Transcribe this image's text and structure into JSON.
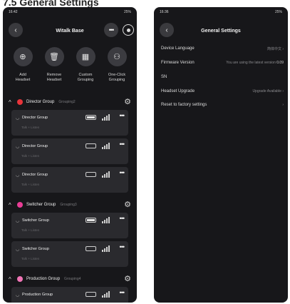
{
  "page_heading": "7.5 General Settings",
  "left": {
    "status_time": "16:42",
    "status_right": "25%",
    "title": "Witalk Base",
    "actions": [
      {
        "label": "Add\nHeadset",
        "icon": "plus-square-icon"
      },
      {
        "label": "Remove\nHeadset",
        "icon": "trash-icon"
      },
      {
        "label": "Custom\nGrouping",
        "icon": "grid-icon"
      },
      {
        "label": "One-Click\nGrouping",
        "icon": "people-icon"
      }
    ],
    "groups": [
      {
        "name": "Director Group",
        "sub": "Grouping2",
        "color": "#e8343a",
        "cards": [
          {
            "name": "Director Group",
            "sub": "Talk + Listen",
            "battery": 0.85
          },
          {
            "name": "Director Group",
            "sub": "Talk + Listen",
            "battery": 0
          },
          {
            "name": "Director Group",
            "sub": "Talk + Listen",
            "battery": 0
          }
        ]
      },
      {
        "name": "Switcher Group",
        "sub": "Grouping3",
        "color": "#e93d96",
        "cards": [
          {
            "name": "Switcher Group",
            "sub": "Talk + Listen",
            "battery": 0.85
          },
          {
            "name": "Switcher Group",
            "sub": "Talk + Listen",
            "battery": 0
          }
        ]
      },
      {
        "name": "Production Group",
        "sub": "Grouping4",
        "color": "#f075b6",
        "cards": [
          {
            "name": "Production Group",
            "sub": "Talk + Listen",
            "battery": 0
          }
        ]
      }
    ]
  },
  "right": {
    "status_time": "16:36",
    "status_right": "25%",
    "title": "General Settings",
    "rows": [
      {
        "label": "Device Language",
        "value": "简体中文"
      },
      {
        "label": "Firmware Version",
        "value": "You are using the latest version",
        "value_strong": "0.09"
      },
      {
        "label": "SN",
        "value": ""
      },
      {
        "label": "Headset Upgrade",
        "value": "Upgrade Available"
      },
      {
        "label": "Reset to factory settings",
        "value": ""
      }
    ]
  },
  "colors": {
    "background": "#17171a",
    "card": "#2a2a2e",
    "button": "#3b3b40"
  }
}
